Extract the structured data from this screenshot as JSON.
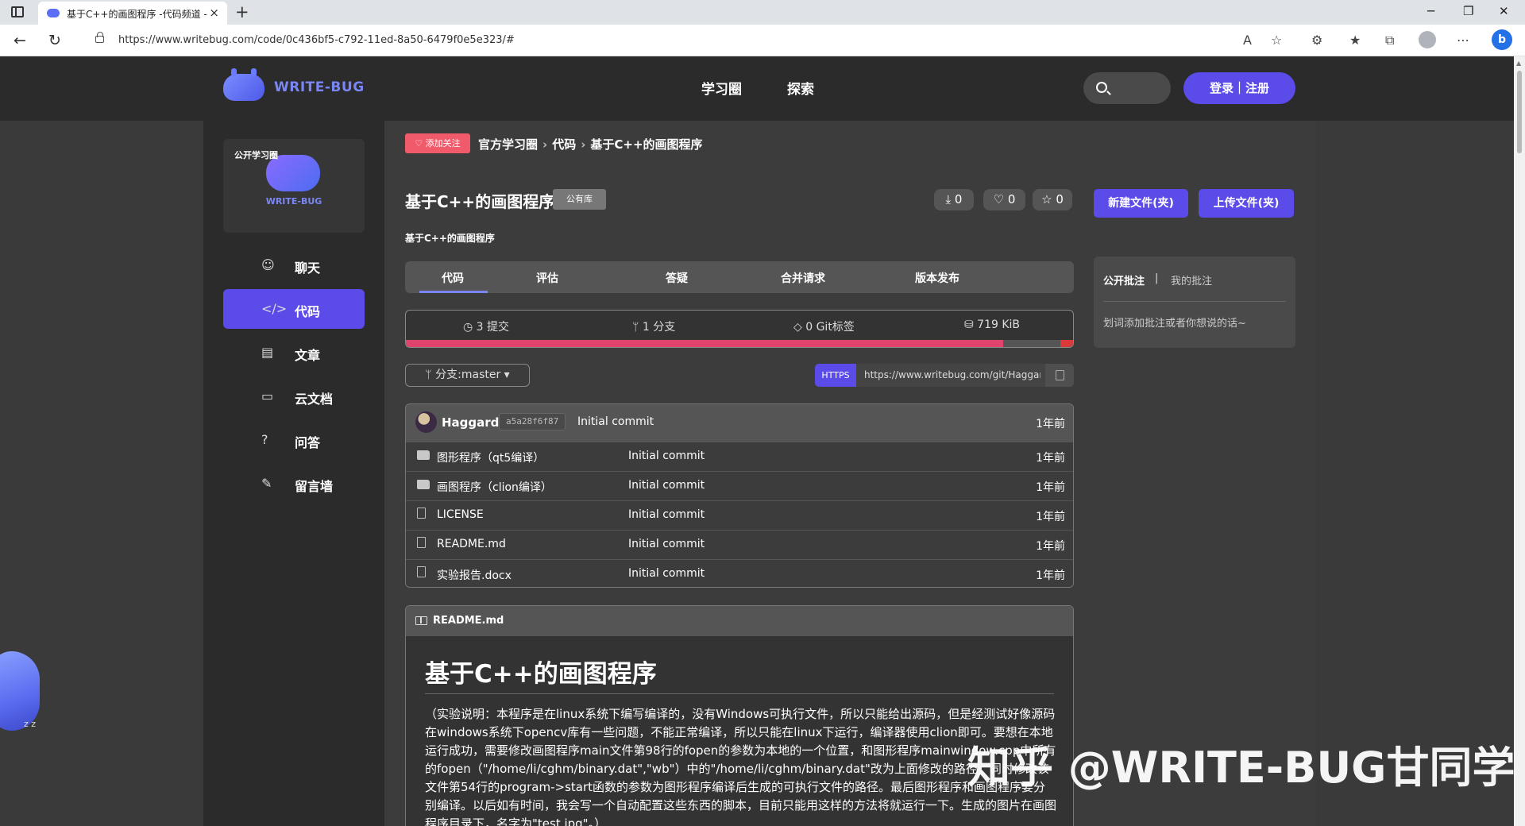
{
  "browser": {
    "tab_title": "基于C++的画图程序 -代码频道 -",
    "tab_close": "×",
    "new_tab": "+",
    "url": "https://www.writebug.com/code/0c436bf5-c792-11ed-8a50-6479f0e5e323/#",
    "win_min": "─",
    "win_max": "❐",
    "win_close": "✕"
  },
  "site": {
    "logo_text": "WRITE-BUG",
    "nav": [
      "学习圈",
      "探索"
    ],
    "login_label": "登录｜注册"
  },
  "sidebar": {
    "group_tag": "公开学习圈",
    "group_name": "WRITE-BUG",
    "items": [
      {
        "label": "聊天",
        "icon": "chat-icon",
        "glyph": "☺"
      },
      {
        "label": "代码",
        "icon": "code-icon",
        "glyph": "</>"
      },
      {
        "label": "文章",
        "icon": "article-icon",
        "glyph": "▤"
      },
      {
        "label": "云文档",
        "icon": "folder-icon",
        "glyph": "▭"
      },
      {
        "label": "问答",
        "icon": "question-icon",
        "glyph": "?"
      },
      {
        "label": "留言墙",
        "icon": "edit-icon",
        "glyph": "✎"
      }
    ],
    "active_index": 1
  },
  "repo": {
    "follow_label": "♡ 添加关注",
    "breadcrumb": [
      "官方学习圈",
      "代码",
      "基于C++的画图程序"
    ],
    "title": "基于C++的画图程序",
    "visibility": "公有库",
    "description": "基于C++的画图程序",
    "downloads": "⤓ 0",
    "likes": "♡ 0",
    "stars": "☆ 0",
    "new_file_label": "新建文件(夹)",
    "upload_file_label": "上传文件(夹)",
    "tabs": [
      "代码",
      "评估",
      "答疑",
      "合并请求",
      "版本发布"
    ],
    "stats": {
      "commits": "◷ 3 提交",
      "branches": "ᛘ 1 分支",
      "tags": "◇ 0 Git标签",
      "size": "⛁ 719 KiB"
    },
    "language_bar": [
      {
        "color": "#e0436b",
        "fraction": 0.893
      },
      {
        "color": "#555555",
        "fraction": 0.085
      },
      {
        "color": "#d83a3a",
        "fraction": 0.022
      }
    ],
    "branch_label": "ᛘ 分支:master ▾",
    "clone_protocol": "HTTPS",
    "clone_url": "https://www.writebug.com/git/Haggard/..."
  },
  "commit": {
    "author": "Haggard",
    "hash": "a5a28f6f87",
    "message": "Initial commit",
    "time": "1年前"
  },
  "files": [
    {
      "type": "folder",
      "name": "图形程序（qt5编译）",
      "message": "Initial commit",
      "time": "1年前"
    },
    {
      "type": "folder",
      "name": "画图程序（clion编译）",
      "message": "Initial commit",
      "time": "1年前"
    },
    {
      "type": "file",
      "name": "LICENSE",
      "message": "Initial commit",
      "time": "1年前"
    },
    {
      "type": "file",
      "name": "README.md",
      "message": "Initial commit",
      "time": "1年前"
    },
    {
      "type": "file",
      "name": "实验报告.docx",
      "message": "Initial commit",
      "time": "1年前"
    }
  ],
  "readme": {
    "filename": "README.md",
    "heading": "基于C++的画图程序",
    "body": "（实验说明：本程序是在linux系统下编写编译的，没有Windows可执行文件，所以只能给出源码，但是经测试好像源码在windows系统下opencv库有一些问题，不能正常编译，所以只能在linux下运行，编译器使用clion即可。要想在本地运行成功，需要修改画图程序main文件第98行的fopen的参数为本地的一个位置，和图形程序mainwindow.cpp中所有的fopen（\"/home/li/cghm/binary.dat\",\"wb\"）中的\"/home/li/cghm/binary.dat\"改为上面修改的路径，同时修改该文件第54行的program->start函数的参数为图形程序编译后生成的可执行文件的路径。最后图形程序和画图程序要分别编译。以后如有时间，我会写一个自动配置这些东西的脚本，目前只能用这样的方法将就运行一下。生成的图片在画图程序目录下，名字为\"test.jpg\"。）"
  },
  "annotation": {
    "tab_public": "公开批注",
    "separator": "|",
    "tab_mine": "我的批注",
    "hint": "划词添加批注或者你想说的话~"
  },
  "floating": {
    "zzz": "z z"
  },
  "watermark": "知乎 @WRITE-BUG甘同学"
}
